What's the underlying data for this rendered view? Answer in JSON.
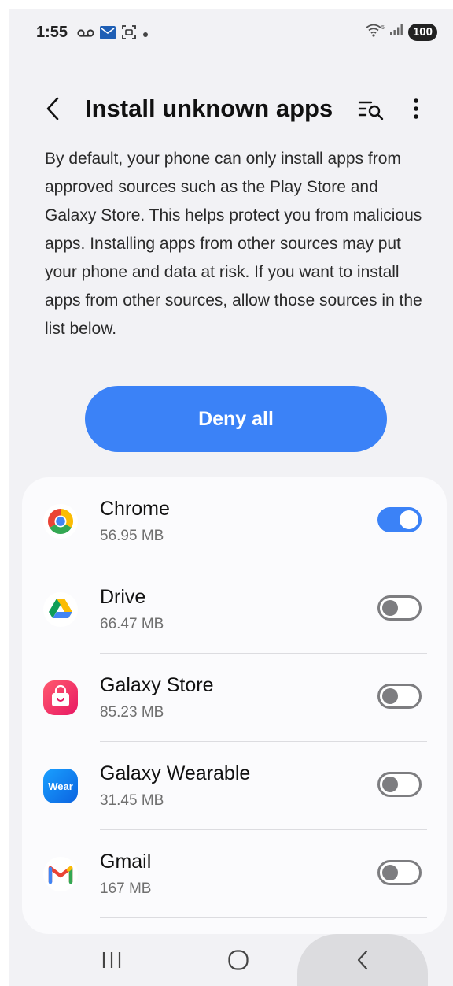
{
  "status_bar": {
    "time": "1:55",
    "battery": "100",
    "icons": [
      "voicemail-icon",
      "mail-icon",
      "screenshot-icon",
      "dot-icon",
      "wifi-icon",
      "signal-icon",
      "battery-icon"
    ]
  },
  "header": {
    "title": "Install unknown apps",
    "icons": [
      "back-icon",
      "search-list-icon",
      "more-vert-icon"
    ]
  },
  "description": "By default, your phone can only install apps from approved sources such as the Play Store and Galaxy Store. This helps protect you from malicious apps. Installing apps from other sources may put your phone and data at risk. If you want to install apps from other sources, allow those sources in the list below.",
  "deny_all": {
    "label": "Deny all"
  },
  "apps": [
    {
      "name": "Chrome",
      "size": "56.95 MB",
      "enabled": true,
      "icon": "chrome-icon"
    },
    {
      "name": "Drive",
      "size": "66.47 MB",
      "enabled": false,
      "icon": "drive-icon"
    },
    {
      "name": "Galaxy Store",
      "size": "85.23 MB",
      "enabled": false,
      "icon": "galaxy-store-icon"
    },
    {
      "name": "Galaxy Wearable",
      "size": "31.45 MB",
      "enabled": false,
      "icon": "galaxy-wearable-icon",
      "icon_text": "Wear"
    },
    {
      "name": "Gmail",
      "size": "167 MB",
      "enabled": false,
      "icon": "gmail-icon"
    }
  ],
  "nav_bar": {
    "icons": [
      "recents-icon",
      "home-icon",
      "back-icon"
    ]
  },
  "colors": {
    "accent": "#3b82f7",
    "background": "#f2f2f5",
    "card": "#fbfbfd",
    "toggle_off": "#7d7d80"
  }
}
